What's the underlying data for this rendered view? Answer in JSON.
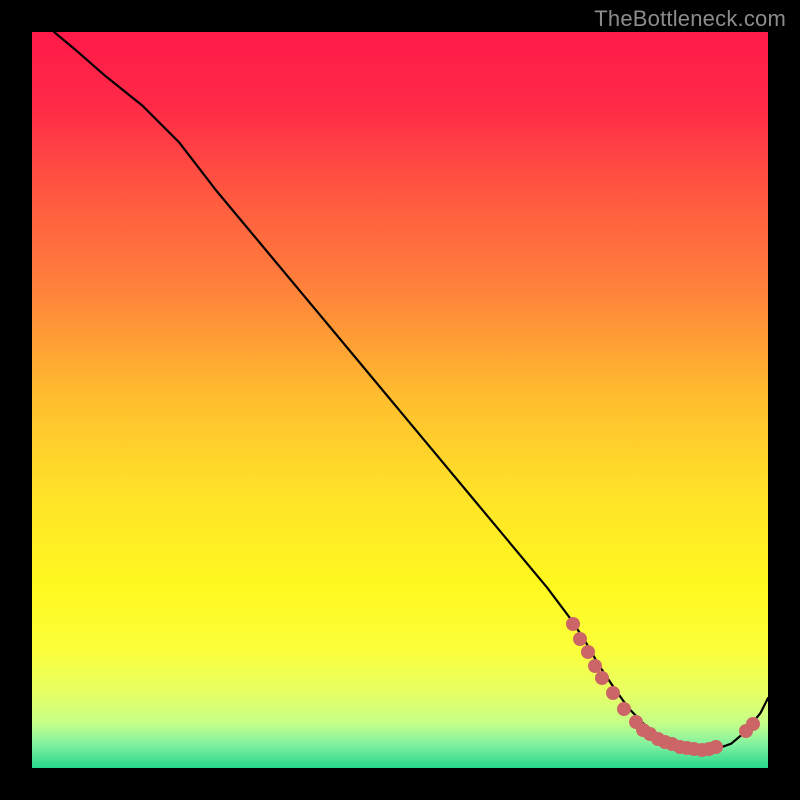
{
  "attribution": "TheBottleneck.com",
  "colors": {
    "gradient_stops": [
      {
        "offset": 0.0,
        "color": "#ff1a49"
      },
      {
        "offset": 0.1,
        "color": "#ff2a47"
      },
      {
        "offset": 0.22,
        "color": "#ff5840"
      },
      {
        "offset": 0.35,
        "color": "#ff823b"
      },
      {
        "offset": 0.5,
        "color": "#ffbf2e"
      },
      {
        "offset": 0.63,
        "color": "#ffe328"
      },
      {
        "offset": 0.75,
        "color": "#fff81f"
      },
      {
        "offset": 0.84,
        "color": "#fbff3a"
      },
      {
        "offset": 0.9,
        "color": "#e6ff66"
      },
      {
        "offset": 0.94,
        "color": "#c4ff8a"
      },
      {
        "offset": 0.97,
        "color": "#7cf0a0"
      },
      {
        "offset": 1.0,
        "color": "#27d68a"
      }
    ],
    "curve_stroke": "#000000",
    "marker_fill": "#cc6666",
    "bg": "#000000"
  },
  "chart_data": {
    "type": "line",
    "title": "",
    "xlabel": "",
    "ylabel": "",
    "xlim": [
      0,
      100
    ],
    "ylim": [
      0,
      100
    ],
    "grid": false,
    "series": [
      {
        "name": "bottleneck-curve",
        "x": [
          3,
          6,
          10,
          15,
          20,
          25,
          30,
          35,
          40,
          45,
          50,
          55,
          60,
          65,
          70,
          73,
          75,
          77,
          79,
          81,
          83,
          85,
          87,
          89,
          91,
          93,
          95,
          97,
          99,
          100
        ],
        "y": [
          100,
          97.5,
          94,
          90,
          85,
          78.5,
          72.5,
          66.5,
          60.5,
          54.5,
          48.5,
          42.5,
          36.5,
          30.5,
          24.5,
          20.5,
          17.5,
          14,
          11,
          8.2,
          6.1,
          4.6,
          3.5,
          2.8,
          2.5,
          2.6,
          3.3,
          5.0,
          7.5,
          9.5
        ]
      }
    ],
    "markers": [
      {
        "x": 73.5,
        "y": 19.5
      },
      {
        "x": 74.5,
        "y": 17.5
      },
      {
        "x": 75.5,
        "y": 15.7
      },
      {
        "x": 76.5,
        "y": 13.8
      },
      {
        "x": 77.5,
        "y": 12.2
      },
      {
        "x": 79.0,
        "y": 10.2
      },
      {
        "x": 80.5,
        "y": 8.0
      },
      {
        "x": 82.0,
        "y": 6.2
      },
      {
        "x": 83.0,
        "y": 5.2
      },
      {
        "x": 84.0,
        "y": 4.6
      },
      {
        "x": 85.0,
        "y": 4.0
      },
      {
        "x": 86.0,
        "y": 3.6
      },
      {
        "x": 87.0,
        "y": 3.2
      },
      {
        "x": 88.0,
        "y": 2.9
      },
      {
        "x": 89.0,
        "y": 2.7
      },
      {
        "x": 90.0,
        "y": 2.6
      },
      {
        "x": 91.0,
        "y": 2.5
      },
      {
        "x": 92.0,
        "y": 2.6
      },
      {
        "x": 93.0,
        "y": 2.8
      },
      {
        "x": 97.0,
        "y": 5.0
      },
      {
        "x": 98.0,
        "y": 6.0
      }
    ]
  }
}
